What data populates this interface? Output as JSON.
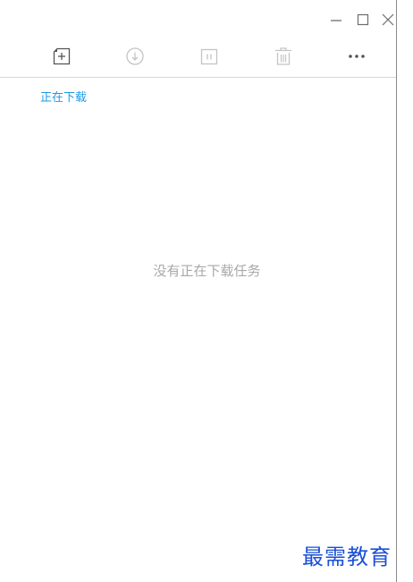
{
  "window_controls": {
    "minimize_icon": "minimize-icon",
    "maximize_icon": "maximize-icon",
    "close_icon": "close-icon"
  },
  "toolbar": {
    "icons": [
      "new-task-icon",
      "download-start-icon",
      "pause-icon",
      "trash-icon",
      "more-icon"
    ]
  },
  "section": {
    "title": "正在下载"
  },
  "content": {
    "empty_message": "没有正在下载任务"
  },
  "watermark": {
    "text": "最需教育"
  },
  "colors": {
    "accent": "#1e9be6",
    "icon_active": "#555555",
    "icon_disabled": "#c4c4c4",
    "empty_text": "#a8a8a8",
    "watermark": "#1a4fd6"
  }
}
